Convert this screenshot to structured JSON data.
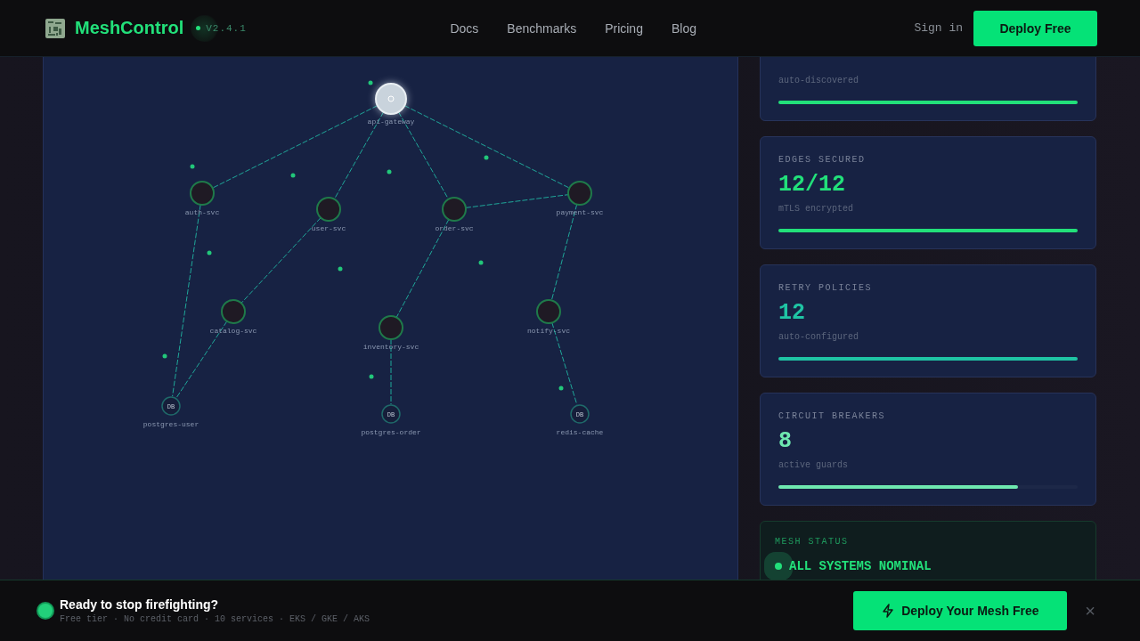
{
  "nav": {
    "brand": "MeshControl",
    "version": "V2.4.1",
    "links": [
      "Docs",
      "Benchmarks",
      "Pricing",
      "Blog"
    ],
    "sign_in": "Sign in",
    "cta": "Deploy Free"
  },
  "graph": {
    "nodes": [
      {
        "label": "api-gateway",
        "kind": "gateway"
      },
      {
        "label": "auth-svc",
        "kind": "service"
      },
      {
        "label": "user-svc",
        "kind": "service"
      },
      {
        "label": "order-svc",
        "kind": "service"
      },
      {
        "label": "payment-svc",
        "kind": "service"
      },
      {
        "label": "catalog-svc",
        "kind": "service"
      },
      {
        "label": "inventory-svc",
        "kind": "service"
      },
      {
        "label": "notify-svc",
        "kind": "service"
      },
      {
        "label": "postgres-user",
        "kind": "database",
        "badge": "DB"
      },
      {
        "label": "postgres-order",
        "kind": "database",
        "badge": "DB"
      },
      {
        "label": "redis-cache",
        "kind": "database",
        "badge": "DB"
      }
    ]
  },
  "stats": [
    {
      "caption": "auto-discovered",
      "level": 1,
      "color": "#22e07a"
    },
    {
      "label": "EDGES SECURED",
      "value": "12/12",
      "caption": "mTLS encrypted",
      "level": 1,
      "color": "#22e07a"
    },
    {
      "label": "RETRY POLICIES",
      "value": "12",
      "caption": "auto-configured",
      "level": 1,
      "color": "#1fc4a4"
    },
    {
      "label": "CIRCUIT BREAKERS",
      "value": "8",
      "caption": "active guards",
      "level": 0.8,
      "color": "#6ee8b0"
    }
  ],
  "mesh_status": {
    "label": "MESH STATUS",
    "status": "ALL SYSTEMS NOMINAL"
  },
  "banner": {
    "title": "Ready to stop firefighting?",
    "subtitle": "Free tier · No credit card · 10 services · EKS / GKE / AKS",
    "cta": "Deploy Your Mesh Free",
    "close": "×"
  }
}
